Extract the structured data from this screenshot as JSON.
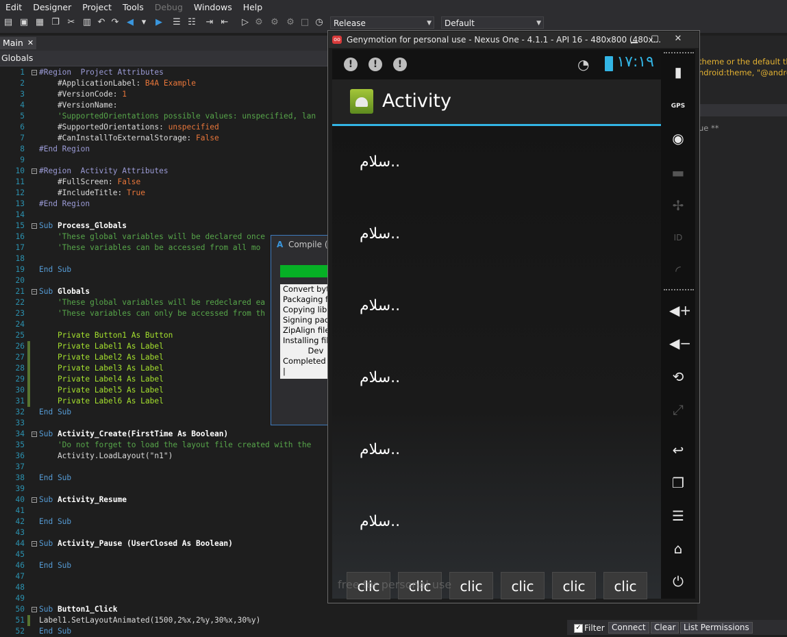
{
  "menubar": {
    "items": [
      "Edit",
      "Designer",
      "Project",
      "Tools",
      "Debug",
      "Windows",
      "Help"
    ]
  },
  "toolbar": {
    "build_config": "Release",
    "device_config": "Default"
  },
  "tabs": {
    "main_label": "Main",
    "close_glyph": "✕"
  },
  "subbar": {
    "module": "Globals"
  },
  "editor": {
    "lines": [
      {
        "n": "1",
        "t": "#Region  Project Attributes"
      },
      {
        "n": "2",
        "t": "    #ApplicationLabel: B4A Example"
      },
      {
        "n": "3",
        "t": "    #VersionCode: 1"
      },
      {
        "n": "4",
        "t": "    #VersionName: "
      },
      {
        "n": "5",
        "t": "    'SupportedOrientations possible values: unspecified, lan"
      },
      {
        "n": "6",
        "t": "    #SupportedOrientations: unspecified"
      },
      {
        "n": "7",
        "t": "    #CanInstallToExternalStorage: False"
      },
      {
        "n": "8",
        "t": "#End Region"
      },
      {
        "n": "9",
        "t": ""
      },
      {
        "n": "10",
        "t": "#Region  Activity Attributes "
      },
      {
        "n": "11",
        "t": "    #FullScreen: False"
      },
      {
        "n": "12",
        "t": "    #IncludeTitle: True"
      },
      {
        "n": "13",
        "t": "#End Region"
      },
      {
        "n": "14",
        "t": ""
      },
      {
        "n": "15",
        "t": "Sub Process_Globals"
      },
      {
        "n": "16",
        "t": "    'These global variables will be declared once"
      },
      {
        "n": "17",
        "t": "    'These variables can be accessed from all mo"
      },
      {
        "n": "18",
        "t": ""
      },
      {
        "n": "19",
        "t": "End Sub"
      },
      {
        "n": "20",
        "t": ""
      },
      {
        "n": "21",
        "t": "Sub Globals"
      },
      {
        "n": "22",
        "t": "    'These global variables will be redeclared ea"
      },
      {
        "n": "23",
        "t": "    'These variables can only be accessed from th"
      },
      {
        "n": "24",
        "t": ""
      },
      {
        "n": "25",
        "t": "    Private Button1 As Button"
      },
      {
        "n": "26",
        "t": "    Private Label1 As Label"
      },
      {
        "n": "27",
        "t": "    Private Label2 As Label"
      },
      {
        "n": "28",
        "t": "    Private Label3 As Label"
      },
      {
        "n": "29",
        "t": "    Private Label4 As Label"
      },
      {
        "n": "30",
        "t": "    Private Label5 As Label"
      },
      {
        "n": "31",
        "t": "    Private Label6 As Label"
      },
      {
        "n": "32",
        "t": "End Sub"
      },
      {
        "n": "33",
        "t": ""
      },
      {
        "n": "34",
        "t": "Sub Activity_Create(FirstTime As Boolean)"
      },
      {
        "n": "35",
        "t": "    'Do not forget to load the layout file created with the"
      },
      {
        "n": "36",
        "t": "    Activity.LoadLayout(\"n1\")"
      },
      {
        "n": "37",
        "t": ""
      },
      {
        "n": "38",
        "t": "End Sub"
      },
      {
        "n": "39",
        "t": ""
      },
      {
        "n": "40",
        "t": "Sub Activity_Resume"
      },
      {
        "n": "41",
        "t": ""
      },
      {
        "n": "42",
        "t": "End Sub"
      },
      {
        "n": "43",
        "t": ""
      },
      {
        "n": "44",
        "t": "Sub Activity_Pause (UserClosed As Boolean)"
      },
      {
        "n": "45",
        "t": ""
      },
      {
        "n": "46",
        "t": "End Sub"
      },
      {
        "n": "47",
        "t": ""
      },
      {
        "n": "48",
        "t": ""
      },
      {
        "n": "49",
        "t": ""
      },
      {
        "n": "50",
        "t": "Sub Button1_Click"
      },
      {
        "n": "51",
        "t": "Label1.SetLayoutAnimated(1500,2%x,2%y,30%x,30%y)"
      },
      {
        "n": "52",
        "t": "End Sub"
      }
    ]
  },
  "right_panel": {
    "warning_text": "theme or the default th\nndroid:theme, \"@androi",
    "note": "ue **"
  },
  "bottom_bar": {
    "filter_label": "Filter",
    "connect_label": "Connect",
    "clear_label": "Clear",
    "permissions_label": "List Permissions"
  },
  "compile_dialog": {
    "title": "Compile (B",
    "log": [
      "Convert byte",
      "Packaging fi",
      "Copying libr",
      "Signing pack",
      "ZipAlign file",
      "Installing file",
      "          Dev",
      "Completed s"
    ],
    "progress": 1.0
  },
  "genymotion": {
    "title": "Genymotion for personal use - Nexus One - 4.1.1 - API 16 - 480x800 (480x...",
    "clock": "١٧:١٩",
    "activity_title": "Activity",
    "labels": [
      "..سلام",
      "..سلام",
      "..سلام",
      "..سلام",
      "..سلام",
      "..سلام"
    ],
    "buttons": [
      "clic",
      "clic",
      "clic",
      "clic",
      "clic",
      "clic"
    ],
    "watermark": "free for personal use",
    "sidebar_icons": [
      "battery-icon",
      "gps-icon",
      "camera-icon",
      "capture-icon",
      "dpad-icon",
      "id-icon",
      "rss-icon",
      "volume-up-icon",
      "volume-down-icon",
      "rotate-icon",
      "fullscreen-icon",
      "back-icon",
      "recent-apps-icon",
      "menu-icon",
      "home-icon",
      "power-icon"
    ]
  },
  "colors": {
    "accent": "#33b5e5",
    "progress": "#06b025",
    "ide_bg": "#1e1e1e"
  }
}
